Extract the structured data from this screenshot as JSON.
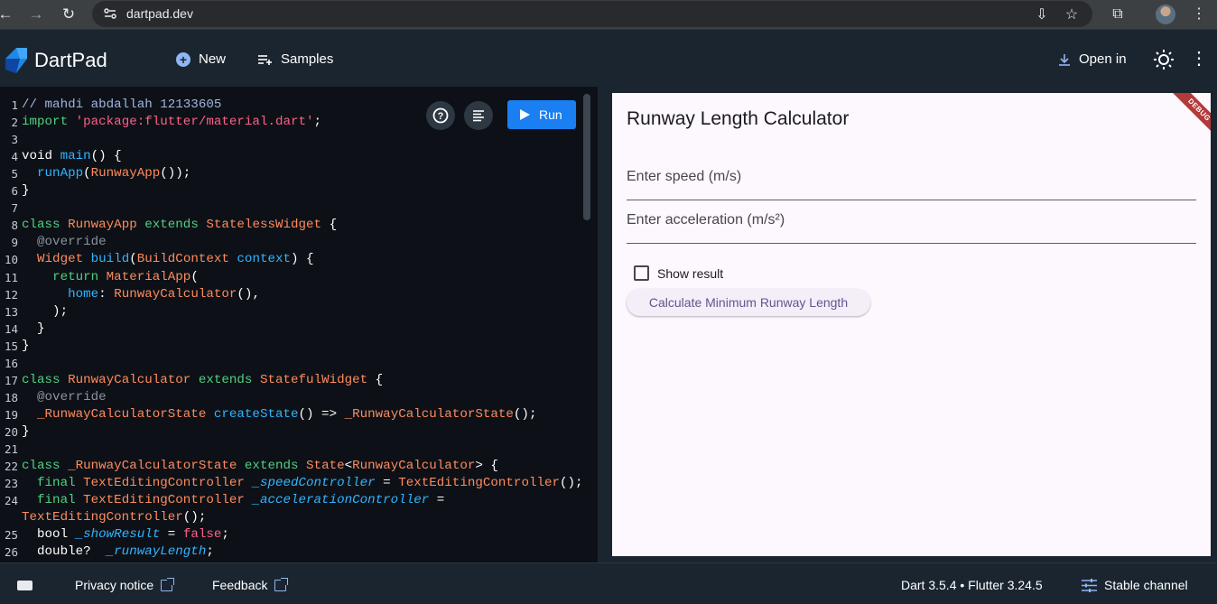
{
  "browser": {
    "url": "dartpad.dev"
  },
  "header": {
    "app_title": "DartPad",
    "new_label": "New",
    "samples_label": "Samples",
    "open_in_label": "Open in"
  },
  "editor": {
    "run_label": "Run",
    "line_numbers": [
      "1",
      "2",
      "3",
      "4",
      "5",
      "6",
      "7",
      "8",
      "9",
      "10",
      "11",
      "12",
      "13",
      "14",
      "15",
      "16",
      "17",
      "18",
      "19",
      "20",
      "21",
      "22",
      "23",
      "24",
      "",
      "25",
      "26"
    ],
    "lines": [
      [
        [
          "c",
          "// mahdi abdallah 12133605"
        ]
      ],
      [
        [
          "k",
          "import"
        ],
        [
          "p",
          " "
        ],
        [
          "s",
          "'package:flutter/material.dart'"
        ],
        [
          "p",
          ";"
        ]
      ],
      [],
      [
        [
          "p",
          "void "
        ],
        [
          "f",
          "main"
        ],
        [
          "p",
          "() {"
        ]
      ],
      [
        [
          "p",
          "  "
        ],
        [
          "f",
          "runApp"
        ],
        [
          "p",
          "("
        ],
        [
          "t",
          "RunwayApp"
        ],
        [
          "p",
          "());"
        ]
      ],
      [
        [
          "p",
          "}"
        ]
      ],
      [],
      [
        [
          "k",
          "class"
        ],
        [
          "p",
          " "
        ],
        [
          "t",
          "RunwayApp"
        ],
        [
          "p",
          " "
        ],
        [
          "k",
          "extends"
        ],
        [
          "p",
          " "
        ],
        [
          "t",
          "StatelessWidget"
        ],
        [
          "p",
          " {"
        ]
      ],
      [
        [
          "p",
          "  "
        ],
        [
          "a",
          "@override"
        ]
      ],
      [
        [
          "p",
          "  "
        ],
        [
          "t",
          "Widget"
        ],
        [
          "p",
          " "
        ],
        [
          "f",
          "build"
        ],
        [
          "p",
          "("
        ],
        [
          "t",
          "BuildContext"
        ],
        [
          "p",
          " "
        ],
        [
          "f",
          "context"
        ],
        [
          "p",
          ") {"
        ]
      ],
      [
        [
          "p",
          "    "
        ],
        [
          "k",
          "return"
        ],
        [
          "p",
          " "
        ],
        [
          "t",
          "MaterialApp"
        ],
        [
          "p",
          "("
        ]
      ],
      [
        [
          "p",
          "      "
        ],
        [
          "f",
          "home"
        ],
        [
          "p",
          ": "
        ],
        [
          "t",
          "RunwayCalculator"
        ],
        [
          "p",
          "(),"
        ]
      ],
      [
        [
          "p",
          "    );"
        ]
      ],
      [
        [
          "p",
          "  }"
        ]
      ],
      [
        [
          "p",
          "}"
        ]
      ],
      [],
      [
        [
          "k",
          "class"
        ],
        [
          "p",
          " "
        ],
        [
          "t",
          "RunwayCalculator"
        ],
        [
          "p",
          " "
        ],
        [
          "k",
          "extends"
        ],
        [
          "p",
          " "
        ],
        [
          "t",
          "StatefulWidget"
        ],
        [
          "p",
          " {"
        ]
      ],
      [
        [
          "p",
          "  "
        ],
        [
          "a",
          "@override"
        ]
      ],
      [
        [
          "p",
          "  "
        ],
        [
          "t",
          "_RunwayCalculatorState"
        ],
        [
          "p",
          " "
        ],
        [
          "f",
          "createState"
        ],
        [
          "p",
          "() => "
        ],
        [
          "t",
          "_RunwayCalculatorState"
        ],
        [
          "p",
          "();"
        ]
      ],
      [
        [
          "p",
          "}"
        ]
      ],
      [],
      [
        [
          "k",
          "class"
        ],
        [
          "p",
          " "
        ],
        [
          "t",
          "_RunwayCalculatorState"
        ],
        [
          "p",
          " "
        ],
        [
          "k",
          "extends"
        ],
        [
          "p",
          " "
        ],
        [
          "t",
          "State"
        ],
        [
          "p",
          "<"
        ],
        [
          "t",
          "RunwayCalculator"
        ],
        [
          "p",
          "> {"
        ]
      ],
      [
        [
          "p",
          "  "
        ],
        [
          "k",
          "final"
        ],
        [
          "p",
          " "
        ],
        [
          "t",
          "TextEditingController"
        ],
        [
          "p",
          " "
        ],
        [
          "v",
          "_speedController"
        ],
        [
          "p",
          " = "
        ],
        [
          "t",
          "TextEditingController"
        ],
        [
          "p",
          "();"
        ]
      ],
      [
        [
          "p",
          "  "
        ],
        [
          "k",
          "final"
        ],
        [
          "p",
          " "
        ],
        [
          "t",
          "TextEditingController"
        ],
        [
          "p",
          " "
        ],
        [
          "v",
          "_accelerationController"
        ],
        [
          "p",
          " ="
        ]
      ],
      [
        [
          "t",
          "TextEditingController"
        ],
        [
          "p",
          "();"
        ]
      ],
      [
        [
          "p",
          "  bool "
        ],
        [
          "v",
          "_showResult"
        ],
        [
          "p",
          " = "
        ],
        [
          "s",
          "false"
        ],
        [
          "p",
          ";"
        ]
      ],
      [
        [
          "p",
          "  double?  "
        ],
        [
          "v",
          "_runwayLength"
        ],
        [
          "p",
          ";"
        ]
      ]
    ]
  },
  "preview": {
    "title": "Runway Length Calculator",
    "debug_banner": "DEBUG",
    "speed_label": "Enter speed (m/s)",
    "acceleration_label": "Enter acceleration (m/s²)",
    "show_result_label": "Show result",
    "calculate_button": "Calculate Minimum Runway Length"
  },
  "footer": {
    "privacy_label": "Privacy notice",
    "feedback_label": "Feedback",
    "version_label": "Dart 3.5.4 • Flutter 3.24.5",
    "channel_label": "Stable channel"
  },
  "colors": {
    "run_button": "#1a7ff0",
    "app_background": "#1b2530",
    "editor_background": "#0d1117",
    "preview_background": "#fdf7fe"
  }
}
